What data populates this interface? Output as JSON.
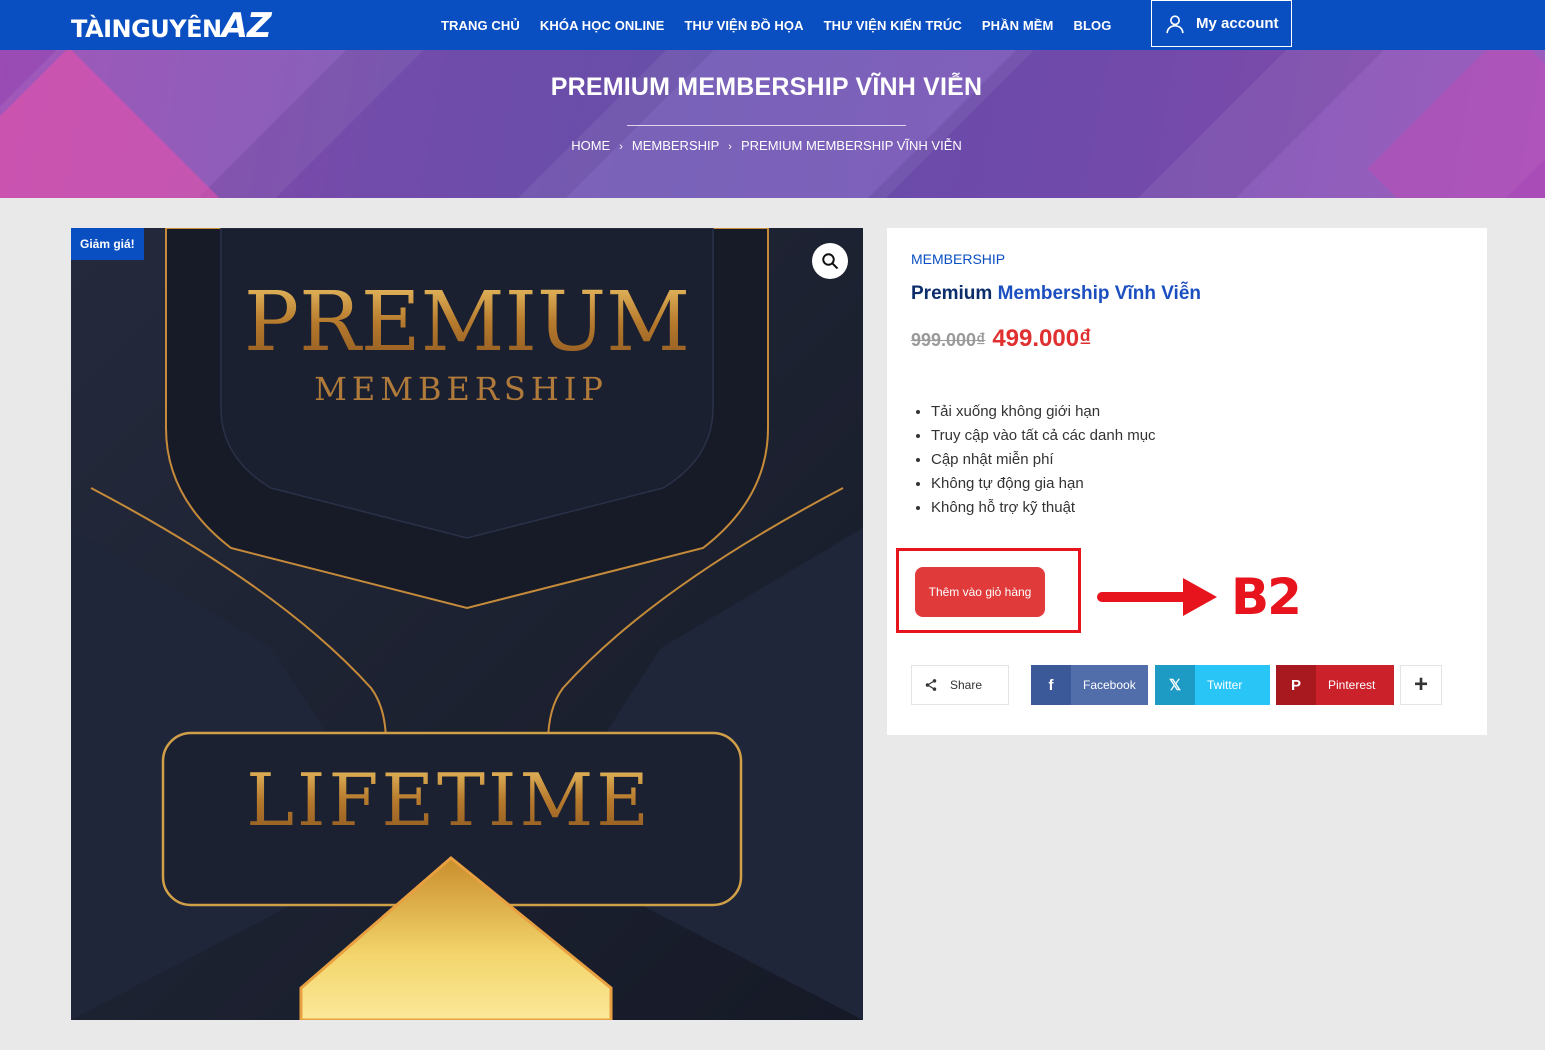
{
  "header": {
    "logo_part1": "TÀINGUYÊN",
    "logo_part2": "AZ",
    "nav": [
      "TRANG CHỦ",
      "KHÓA HỌC ONLINE",
      "THƯ VIỆN ĐỒ HỌA",
      "THƯ VIỆN KIẾN TRÚC",
      "PHẦN MỀM",
      "BLOG"
    ],
    "account_label": "My account",
    "account_icon": "user-icon"
  },
  "hero": {
    "title": "PREMIUM MEMBERSHIP VĨNH VIỄN",
    "breadcrumb": [
      "HOME",
      "MEMBERSHIP",
      "PREMIUM MEMBERSHIP VĨNH VIỄN"
    ]
  },
  "product_image": {
    "badge": "Giảm giá!",
    "zoom_icon": "magnifier-icon",
    "line1": "PREMIUM",
    "line2": "MEMBERSHIP",
    "line3": "LIFETIME"
  },
  "product": {
    "category": "MEMBERSHIP",
    "title_part1": "Premium ",
    "title_part2": "Membership Vĩnh Viễn",
    "old_price": "999.000₫",
    "new_price": "499.000₫",
    "features": [
      "Tải xuống không giới hạn",
      "Truy cập vào tất cả các danh mục",
      "Cập nhật miễn phí",
      "Không tự động gia hạn",
      "Không hỗ trợ kỹ thuật"
    ],
    "add_to_cart": "Thêm vào giỏ hàng",
    "annotation": "B2"
  },
  "share": {
    "label": "Share",
    "facebook": "Facebook",
    "twitter": "Twitter",
    "pinterest": "Pinterest",
    "more": "+"
  },
  "colors": {
    "brand": "#0a4fc2",
    "price_red": "#e03030",
    "annotation_red": "#e8141d"
  }
}
